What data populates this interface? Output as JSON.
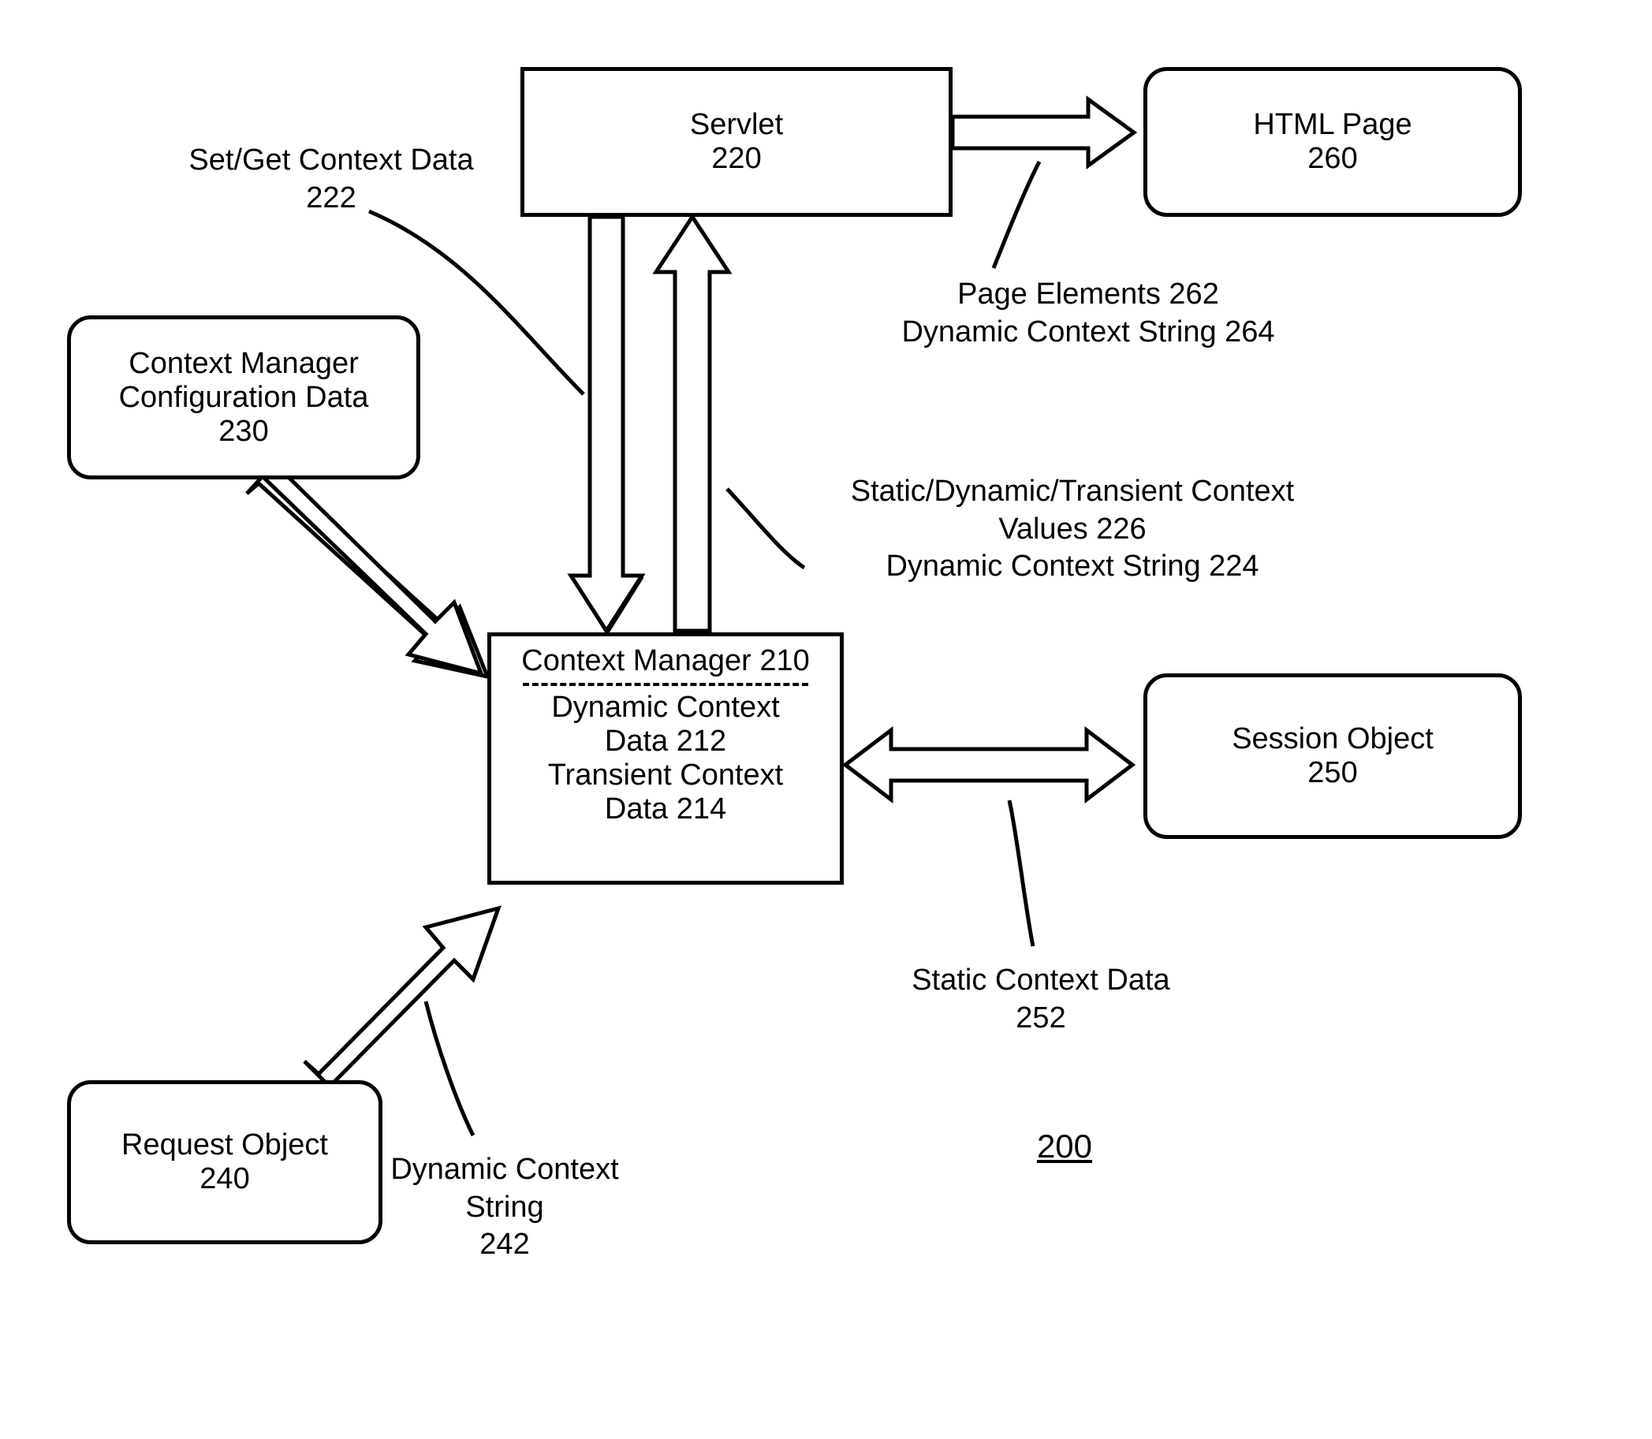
{
  "figure_number": "200",
  "boxes": {
    "servlet": {
      "title": "Servlet",
      "ref": "220"
    },
    "html_page": {
      "title": "HTML Page",
      "ref": "260"
    },
    "config": {
      "line1": "Context Manager",
      "line2": "Configuration Data",
      "ref": "230"
    },
    "context_manager": {
      "title": "Context Manager 210",
      "dyn1": "Dynamic Context",
      "dyn2": "Data 212",
      "trans1": "Transient Context",
      "trans2": "Data 214"
    },
    "session": {
      "title": "Session Object",
      "ref": "250"
    },
    "request": {
      "title": "Request Object",
      "ref": "240"
    }
  },
  "labels": {
    "setget": {
      "line1": "Set/Get Context Data",
      "line2": "222"
    },
    "page_elements": {
      "line1": "Page Elements 262",
      "line2": "Dynamic Context String 264"
    },
    "context_values": {
      "line1": "Static/Dynamic/Transient Context",
      "line2": "Values 226",
      "line3": "Dynamic Context String 224"
    },
    "static_data": {
      "line1": "Static Context Data",
      "line2": "252"
    },
    "dyn_string": {
      "line1": "Dynamic Context",
      "line2": "String",
      "line3": "242"
    }
  }
}
